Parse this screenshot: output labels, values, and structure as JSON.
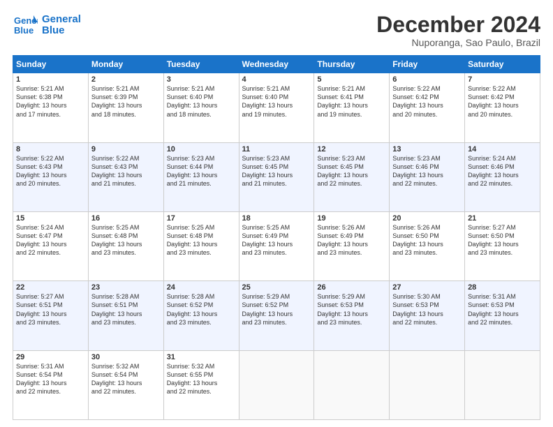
{
  "logo": {
    "line1": "General",
    "line2": "Blue"
  },
  "title": "December 2024",
  "subtitle": "Nuporanga, Sao Paulo, Brazil",
  "days_of_week": [
    "Sunday",
    "Monday",
    "Tuesday",
    "Wednesday",
    "Thursday",
    "Friday",
    "Saturday"
  ],
  "weeks": [
    [
      {
        "day": "1",
        "info": "Sunrise: 5:21 AM\nSunset: 6:38 PM\nDaylight: 13 hours\nand 17 minutes."
      },
      {
        "day": "2",
        "info": "Sunrise: 5:21 AM\nSunset: 6:39 PM\nDaylight: 13 hours\nand 18 minutes."
      },
      {
        "day": "3",
        "info": "Sunrise: 5:21 AM\nSunset: 6:40 PM\nDaylight: 13 hours\nand 18 minutes."
      },
      {
        "day": "4",
        "info": "Sunrise: 5:21 AM\nSunset: 6:40 PM\nDaylight: 13 hours\nand 19 minutes."
      },
      {
        "day": "5",
        "info": "Sunrise: 5:21 AM\nSunset: 6:41 PM\nDaylight: 13 hours\nand 19 minutes."
      },
      {
        "day": "6",
        "info": "Sunrise: 5:22 AM\nSunset: 6:42 PM\nDaylight: 13 hours\nand 20 minutes."
      },
      {
        "day": "7",
        "info": "Sunrise: 5:22 AM\nSunset: 6:42 PM\nDaylight: 13 hours\nand 20 minutes."
      }
    ],
    [
      {
        "day": "8",
        "info": "Sunrise: 5:22 AM\nSunset: 6:43 PM\nDaylight: 13 hours\nand 20 minutes."
      },
      {
        "day": "9",
        "info": "Sunrise: 5:22 AM\nSunset: 6:43 PM\nDaylight: 13 hours\nand 21 minutes."
      },
      {
        "day": "10",
        "info": "Sunrise: 5:23 AM\nSunset: 6:44 PM\nDaylight: 13 hours\nand 21 minutes."
      },
      {
        "day": "11",
        "info": "Sunrise: 5:23 AM\nSunset: 6:45 PM\nDaylight: 13 hours\nand 21 minutes."
      },
      {
        "day": "12",
        "info": "Sunrise: 5:23 AM\nSunset: 6:45 PM\nDaylight: 13 hours\nand 22 minutes."
      },
      {
        "day": "13",
        "info": "Sunrise: 5:23 AM\nSunset: 6:46 PM\nDaylight: 13 hours\nand 22 minutes."
      },
      {
        "day": "14",
        "info": "Sunrise: 5:24 AM\nSunset: 6:46 PM\nDaylight: 13 hours\nand 22 minutes."
      }
    ],
    [
      {
        "day": "15",
        "info": "Sunrise: 5:24 AM\nSunset: 6:47 PM\nDaylight: 13 hours\nand 22 minutes."
      },
      {
        "day": "16",
        "info": "Sunrise: 5:25 AM\nSunset: 6:48 PM\nDaylight: 13 hours\nand 23 minutes."
      },
      {
        "day": "17",
        "info": "Sunrise: 5:25 AM\nSunset: 6:48 PM\nDaylight: 13 hours\nand 23 minutes."
      },
      {
        "day": "18",
        "info": "Sunrise: 5:25 AM\nSunset: 6:49 PM\nDaylight: 13 hours\nand 23 minutes."
      },
      {
        "day": "19",
        "info": "Sunrise: 5:26 AM\nSunset: 6:49 PM\nDaylight: 13 hours\nand 23 minutes."
      },
      {
        "day": "20",
        "info": "Sunrise: 5:26 AM\nSunset: 6:50 PM\nDaylight: 13 hours\nand 23 minutes."
      },
      {
        "day": "21",
        "info": "Sunrise: 5:27 AM\nSunset: 6:50 PM\nDaylight: 13 hours\nand 23 minutes."
      }
    ],
    [
      {
        "day": "22",
        "info": "Sunrise: 5:27 AM\nSunset: 6:51 PM\nDaylight: 13 hours\nand 23 minutes."
      },
      {
        "day": "23",
        "info": "Sunrise: 5:28 AM\nSunset: 6:51 PM\nDaylight: 13 hours\nand 23 minutes."
      },
      {
        "day": "24",
        "info": "Sunrise: 5:28 AM\nSunset: 6:52 PM\nDaylight: 13 hours\nand 23 minutes."
      },
      {
        "day": "25",
        "info": "Sunrise: 5:29 AM\nSunset: 6:52 PM\nDaylight: 13 hours\nand 23 minutes."
      },
      {
        "day": "26",
        "info": "Sunrise: 5:29 AM\nSunset: 6:53 PM\nDaylight: 13 hours\nand 23 minutes."
      },
      {
        "day": "27",
        "info": "Sunrise: 5:30 AM\nSunset: 6:53 PM\nDaylight: 13 hours\nand 22 minutes."
      },
      {
        "day": "28",
        "info": "Sunrise: 5:31 AM\nSunset: 6:53 PM\nDaylight: 13 hours\nand 22 minutes."
      }
    ],
    [
      {
        "day": "29",
        "info": "Sunrise: 5:31 AM\nSunset: 6:54 PM\nDaylight: 13 hours\nand 22 minutes."
      },
      {
        "day": "30",
        "info": "Sunrise: 5:32 AM\nSunset: 6:54 PM\nDaylight: 13 hours\nand 22 minutes."
      },
      {
        "day": "31",
        "info": "Sunrise: 5:32 AM\nSunset: 6:55 PM\nDaylight: 13 hours\nand 22 minutes."
      },
      {
        "day": "",
        "info": ""
      },
      {
        "day": "",
        "info": ""
      },
      {
        "day": "",
        "info": ""
      },
      {
        "day": "",
        "info": ""
      }
    ]
  ]
}
